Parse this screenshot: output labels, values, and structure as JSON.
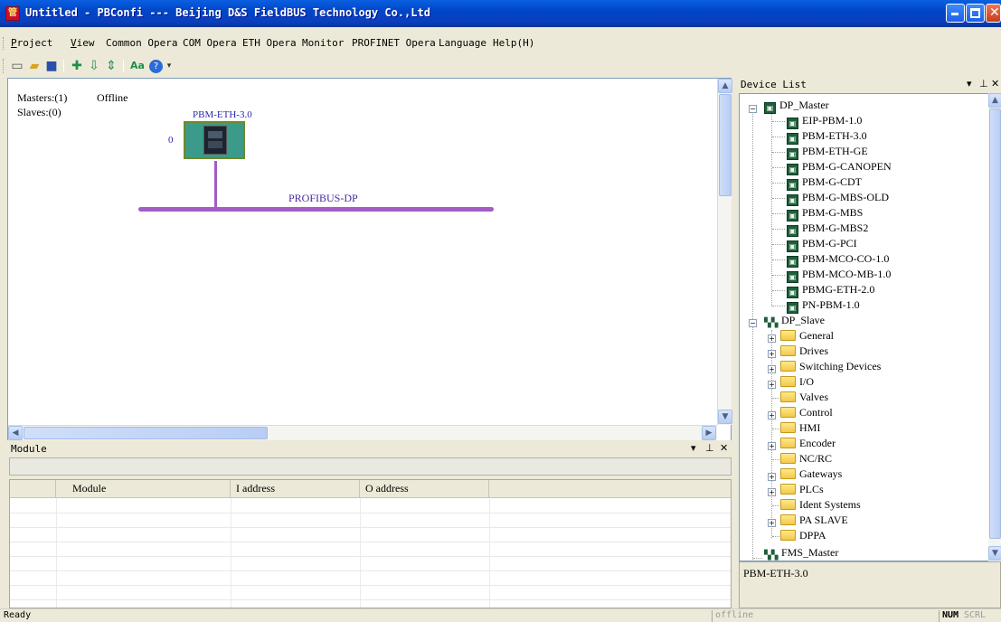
{
  "window": {
    "title": "Untitled - PBConfi --- Beijing D&S FieldBUS Technology Co.,Ltd",
    "app_icon_glyph": "管"
  },
  "menu": [
    {
      "label": "Project",
      "underline": "P"
    },
    {
      "label": "View",
      "underline": "V"
    },
    {
      "label": "Common Opera",
      "underline": ""
    },
    {
      "label": "COM Opera",
      "underline": ""
    },
    {
      "label": "ETH Opera",
      "underline": ""
    },
    {
      "label": "Monitor",
      "underline": ""
    },
    {
      "label": "PROFINET Opera",
      "underline": ""
    },
    {
      "label": "Language",
      "underline": ""
    },
    {
      "label": "Help(H)",
      "underline": ""
    }
  ],
  "toolbar": [
    {
      "name": "new-file-icon",
      "glyph": "🗋"
    },
    {
      "name": "open-folder-icon",
      "glyph": "📂"
    },
    {
      "name": "save-icon",
      "glyph": "💾"
    },
    {
      "name": "add-icon",
      "glyph": "✚"
    },
    {
      "name": "arrow-down-icon",
      "glyph": "⇩"
    },
    {
      "name": "move-updown-icon",
      "glyph": "⇕"
    },
    {
      "name": "font-icon",
      "glyph": "Aa"
    },
    {
      "name": "help-icon",
      "glyph": "❓"
    }
  ],
  "canvas": {
    "masters": "Masters:(1)",
    "slaves": "Slaves:(0)",
    "status": "Offline",
    "device_name": "PBM-ETH-3.0",
    "device_address": "0",
    "bus_label": "PROFIBUS-DP"
  },
  "module_pane": {
    "title": "Module",
    "columns": [
      "",
      "Module",
      "I address",
      "O address",
      ""
    ]
  },
  "device_list": {
    "title": "Device List",
    "dp_master": {
      "label": "DP_Master",
      "items": [
        "EIP-PBM-1.0",
        "PBM-ETH-3.0",
        "PBM-ETH-GE",
        "PBM-G-CANOPEN",
        "PBM-G-CDT",
        "PBM-G-MBS-OLD",
        "PBM-G-MBS",
        "PBM-G-MBS2",
        "PBM-G-PCI",
        "PBM-MCO-CO-1.0",
        "PBM-MCO-MB-1.0",
        "PBMG-ETH-2.0",
        "PN-PBM-1.0"
      ]
    },
    "dp_slave": {
      "label": "DP_Slave",
      "items": [
        {
          "label": "General",
          "expandable": true
        },
        {
          "label": "Drives",
          "expandable": true
        },
        {
          "label": "Switching Devices",
          "expandable": true
        },
        {
          "label": "I/O",
          "expandable": true
        },
        {
          "label": "Valves",
          "expandable": false
        },
        {
          "label": "Control",
          "expandable": true
        },
        {
          "label": "HMI",
          "expandable": false
        },
        {
          "label": "Encoder",
          "expandable": true
        },
        {
          "label": "NC/RC",
          "expandable": false
        },
        {
          "label": "Gateways",
          "expandable": true
        },
        {
          "label": "PLCs",
          "expandable": true
        },
        {
          "label": "Ident Systems",
          "expandable": false
        },
        {
          "label": "PA SLAVE",
          "expandable": true
        },
        {
          "label": "DPPA",
          "expandable": false
        }
      ]
    },
    "fms_master": {
      "label": "FMS_Master"
    },
    "selected_device": "PBM-ETH-3.0"
  },
  "statusbar": {
    "left": "Ready",
    "mode": "offline",
    "num": "NUM",
    "scrl": "SCRL"
  },
  "colors": {
    "bus": "#a45cc6",
    "device_border": "#4c7a1c",
    "device_fill": "#3c9a8a"
  }
}
